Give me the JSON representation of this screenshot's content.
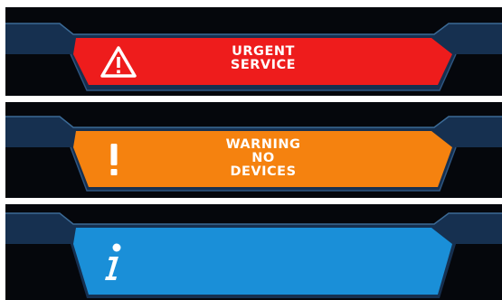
{
  "alerts": [
    {
      "severity": "urgent",
      "icon": "warning-triangle-icon",
      "lines": [
        "URGENT",
        "SERVICE"
      ],
      "color": "#ee1c1c"
    },
    {
      "severity": "warning",
      "icon": "exclamation-icon",
      "icon_glyph": "!",
      "lines": [
        "WARNING",
        "NO",
        "DEVICES"
      ],
      "color": "#f5820f"
    },
    {
      "severity": "info",
      "icon": "info-icon",
      "icon_glyph": "i",
      "lines": [],
      "color": "#1a8fd8"
    }
  ],
  "colors": {
    "background": "#05070c",
    "frame": "#1a3555",
    "frame_highlight": "#3b6a96"
  }
}
